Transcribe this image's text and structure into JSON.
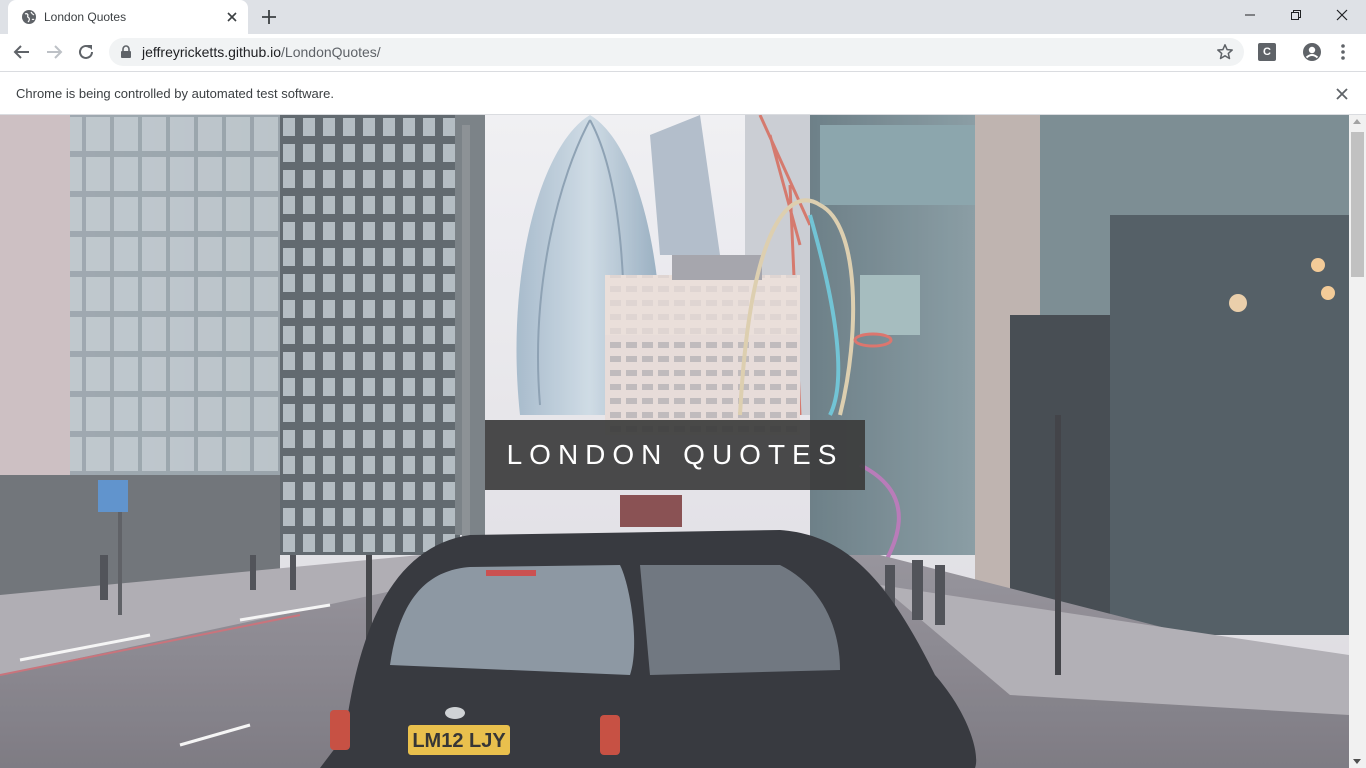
{
  "browser": {
    "tab": {
      "title": "London Quotes",
      "favicon": "globe-icon",
      "close_icon": "close-icon"
    },
    "new_tab_icon": "plus-icon",
    "window_controls": [
      "minimize-icon",
      "restore-icon",
      "close-icon"
    ],
    "toolbar": {
      "back_icon": "arrow-left-icon",
      "forward_icon": "arrow-right-icon",
      "reload_icon": "reload-icon",
      "url_host": "jeffreyricketts.github.io",
      "url_path": "/LondonQuotes/",
      "bookmark_icon": "star-icon",
      "extension_label": "C",
      "profile_icon": "account-icon",
      "menu_icon": "kebab-menu-icon"
    },
    "infobar": {
      "message": "Chrome is being controlled by automated test software.",
      "close_icon": "close-icon"
    }
  },
  "page": {
    "hero_title": "LONDON QUOTES",
    "hero_image": "london-street-photo",
    "license_plate": "LM12 LJY"
  },
  "colors": {
    "tabstrip": "#dee1e6",
    "omnibox": "#f1f3f4",
    "title_box": "#3c3c3c",
    "taxi": "#1d1f26",
    "plate": "#e6b835"
  }
}
